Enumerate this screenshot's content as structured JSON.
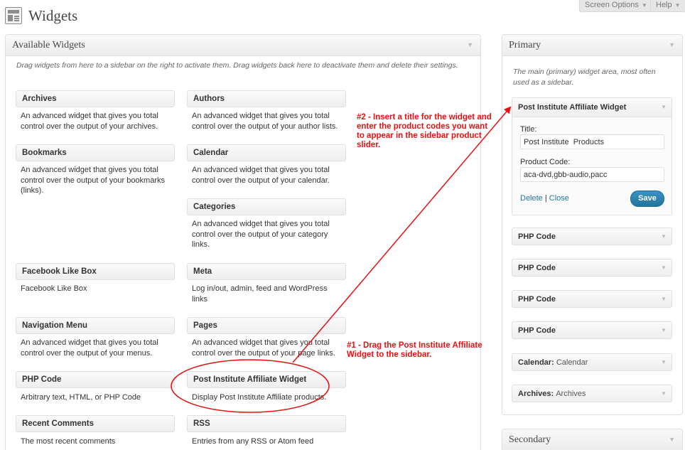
{
  "page": {
    "title": "Widgets"
  },
  "screen_meta": {
    "screen_options": "Screen Options",
    "help": "Help"
  },
  "available": {
    "title": "Available Widgets",
    "description": "Drag widgets from here to a sidebar on the right to activate them. Drag widgets back here to deactivate them and delete their settings.",
    "widgets": [
      {
        "name": "Archives",
        "desc": "An advanced widget that gives you total control over the output of your archives."
      },
      {
        "name": "Authors",
        "desc": "An advanced widget that gives you total control over the output of your author lists."
      },
      {
        "name": "Bookmarks",
        "desc": "An advanced widget that gives you total control over the output of your bookmarks (links)."
      },
      {
        "name": "Calendar",
        "desc": "An advanced widget that gives you total control over the output of your calendar."
      },
      {
        "name": "Categories",
        "desc": "An advanced widget that gives you total control over the output of your category links."
      },
      {
        "name": "Facebook Like Box",
        "desc": "Facebook Like Box"
      },
      {
        "name": "Meta",
        "desc": "Log in/out, admin, feed and WordPress links"
      },
      {
        "name": "Navigation Menu",
        "desc": "An advanced widget that gives you total control over the output of your menus."
      },
      {
        "name": "Pages",
        "desc": "An advanced widget that gives you total control over the output of your page links."
      },
      {
        "name": "PHP Code",
        "desc": "Arbitrary text, HTML, or PHP Code"
      },
      {
        "name": "Post Institute Affiliate Widget",
        "desc": "Display Post Institute Affiliate products."
      },
      {
        "name": "Recent Comments",
        "desc": "The most recent comments"
      },
      {
        "name": "RSS",
        "desc": "Entries from any RSS or Atom feed"
      }
    ]
  },
  "annotations": {
    "step2": "#2 - Insert a title for the widget and enter the product codes you want to appear in the sidebar product slider.",
    "step1": "#1 - Drag the Post Institute Affiliate Widget to the sidebar."
  },
  "primary": {
    "title": "Primary",
    "description": "The main (primary) widget area, most often used as a sidebar.",
    "open_widget": {
      "title": "Post Institute Affiliate Widget",
      "title_label": "Title:",
      "title_value": "Post Institute  Products",
      "code_label": "Product Code:",
      "code_value": "aca-dvd,gbb-audio,pacc",
      "delete": "Delete",
      "separator": "|",
      "close": "Close",
      "save": "Save"
    },
    "widgets": [
      {
        "name": "PHP Code",
        "sub": ""
      },
      {
        "name": "PHP Code",
        "sub": ""
      },
      {
        "name": "PHP Code",
        "sub": ""
      },
      {
        "name": "PHP Code",
        "sub": ""
      },
      {
        "name": "Calendar:",
        "sub": "Calendar"
      },
      {
        "name": "Archives:",
        "sub": "Archives"
      }
    ]
  },
  "secondary": {
    "title": "Secondary"
  },
  "colors": {
    "annotation": "#e81010",
    "save_button": "#21759b",
    "link": "#21759b"
  }
}
